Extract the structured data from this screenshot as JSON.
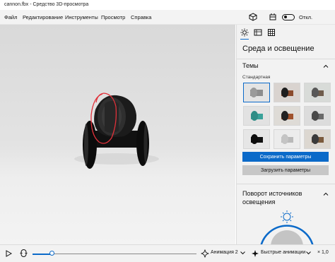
{
  "window": {
    "title": "cannon.fbx - Средство 3D-просмотра"
  },
  "menu": {
    "items": [
      "Файл",
      "Редактирование",
      "Инструменты",
      "Просмотр",
      "Справка"
    ],
    "toggle_label": "Откл."
  },
  "panel": {
    "tabs": [
      "sun-icon",
      "grid-stats-icon",
      "mesh-grid-icon"
    ],
    "title": "Среда и освещение",
    "themes_header": "Темы",
    "preset_label": "Стандартная",
    "save_button": "Сохранить параметры",
    "load_button": "Загрузить параметры",
    "rotate_header": "Поворот источников освещения"
  },
  "bottombar": {
    "animation_label": "Анимация 2",
    "quick_animations_label": "Быстрые анимации",
    "speed_label": "× 1,0",
    "progress": 0.12
  },
  "colors": {
    "accent": "#0b6ac9",
    "annotation": "#e0313a"
  }
}
